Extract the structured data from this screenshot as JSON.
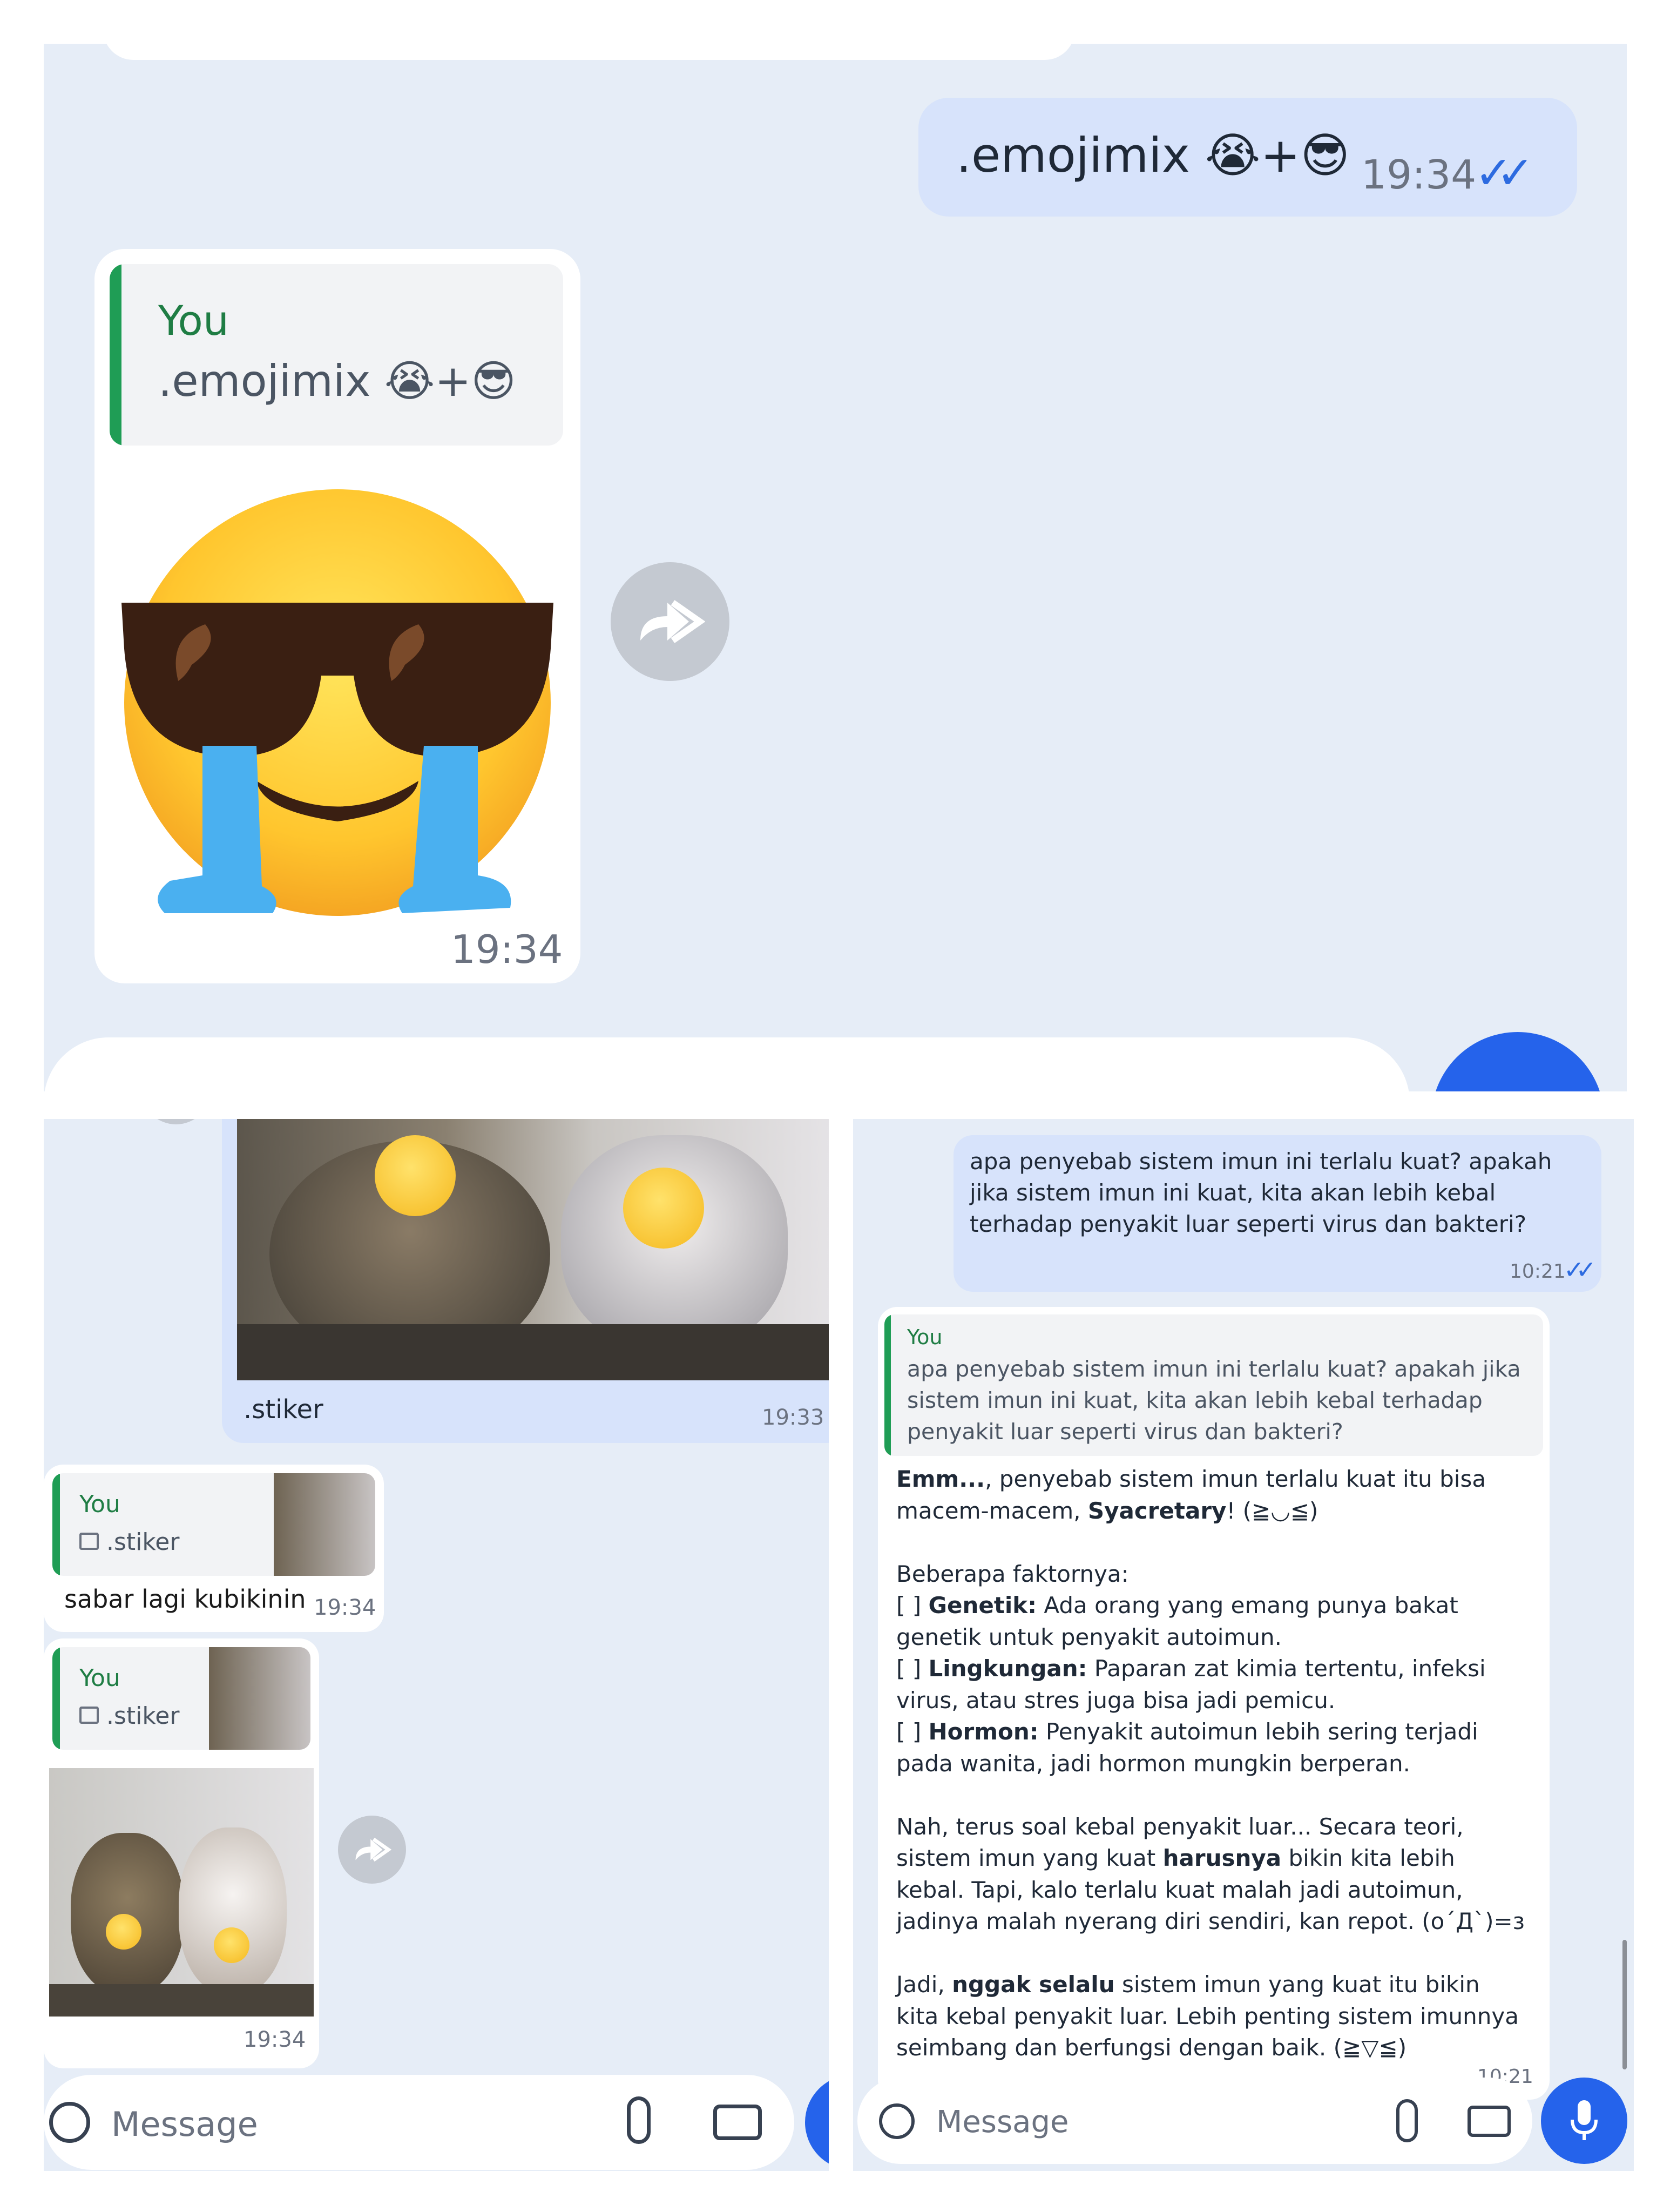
{
  "panel1": {
    "outgoing": {
      "text": ".emojimix 😭+😎",
      "time": "19:34",
      "ticks": "✓✓"
    },
    "reply": {
      "quote_author": "You",
      "quote_text": ".emojimix 😭+😎",
      "sticker_icon": "crying-sunglasses-emoji-sticker",
      "time": "19:34"
    },
    "forward_icon": "forward-icon"
  },
  "panel2": {
    "sticker_caption": ".stiker",
    "sticker_time": "19:33",
    "reply1": {
      "quote_author": "You",
      "quote_text": ".stiker",
      "text": "sabar lagi kubikinin",
      "time": "19:34"
    },
    "reply2": {
      "quote_author": "You",
      "quote_text": ".stiker",
      "time": "19:34"
    },
    "composer": {
      "placeholder": "Message"
    }
  },
  "panel3": {
    "outgoing": {
      "text": "apa penyebab sistem imun ini terlalu kuat? apakah jika sistem imun ini kuat, kita akan lebih kebal terhadap penyakit luar seperti virus dan bakteri?",
      "time": "10:21"
    },
    "reply": {
      "quote_author": "You",
      "quote_text": "apa penyebab sistem imun ini terlalu kuat? apakah jika sistem imun ini kuat, kita akan lebih kebal terhadap penyakit luar seperti virus dan bakteri?",
      "line1_bold": "Emm...",
      "line1_rest": ", penyebab sistem imun terlalu kuat itu bisa macem-macem, ",
      "line1_name": "Syacretary",
      "line1_end": "! (≧◡≦)",
      "factors_heading": "Beberapa faktornya:",
      "factors": [
        {
          "prefix": "[ ] ",
          "bold": "Genetik:",
          "text": " Ada orang yang emang punya bakat genetik untuk penyakit autoimun."
        },
        {
          "prefix": "[ ] ",
          "bold": "Lingkungan:",
          "text": " Paparan zat kimia tertentu, infeksi virus, atau stres juga bisa jadi pemicu."
        },
        {
          "prefix": "[ ] ",
          "bold": "Hormon:",
          "text": " Penyakit autoimun lebih sering terjadi pada wanita, jadi hormon mungkin berperan."
        }
      ],
      "para2_a": "Nah, terus soal kebal penyakit luar... Secara teori, sistem imun yang kuat ",
      "para2_bold": "harusnya",
      "para2_b": " bikin kita lebih kebal. Tapi, kalo terlalu kuat malah jadi autoimun, jadinya malah nyerang diri sendiri, kan repot. (o´Д`)=з",
      "para3_a": "Jadi, ",
      "para3_bold": "nggak selalu",
      "para3_b": " sistem imun yang kuat itu bikin kita kebal penyakit luar. Lebih penting sistem imunnya seimbang dan berfungsi dengan baik. (≧▽≦)",
      "time": "10:21"
    },
    "composer": {
      "placeholder": "Message"
    }
  },
  "colors": {
    "outgoing_bubble": "#d7e3fb",
    "chat_bg": "#e6edf7",
    "quote_bar": "#1f9d55",
    "send_button": "#2563eb",
    "read_ticks": "#2d6be0"
  }
}
